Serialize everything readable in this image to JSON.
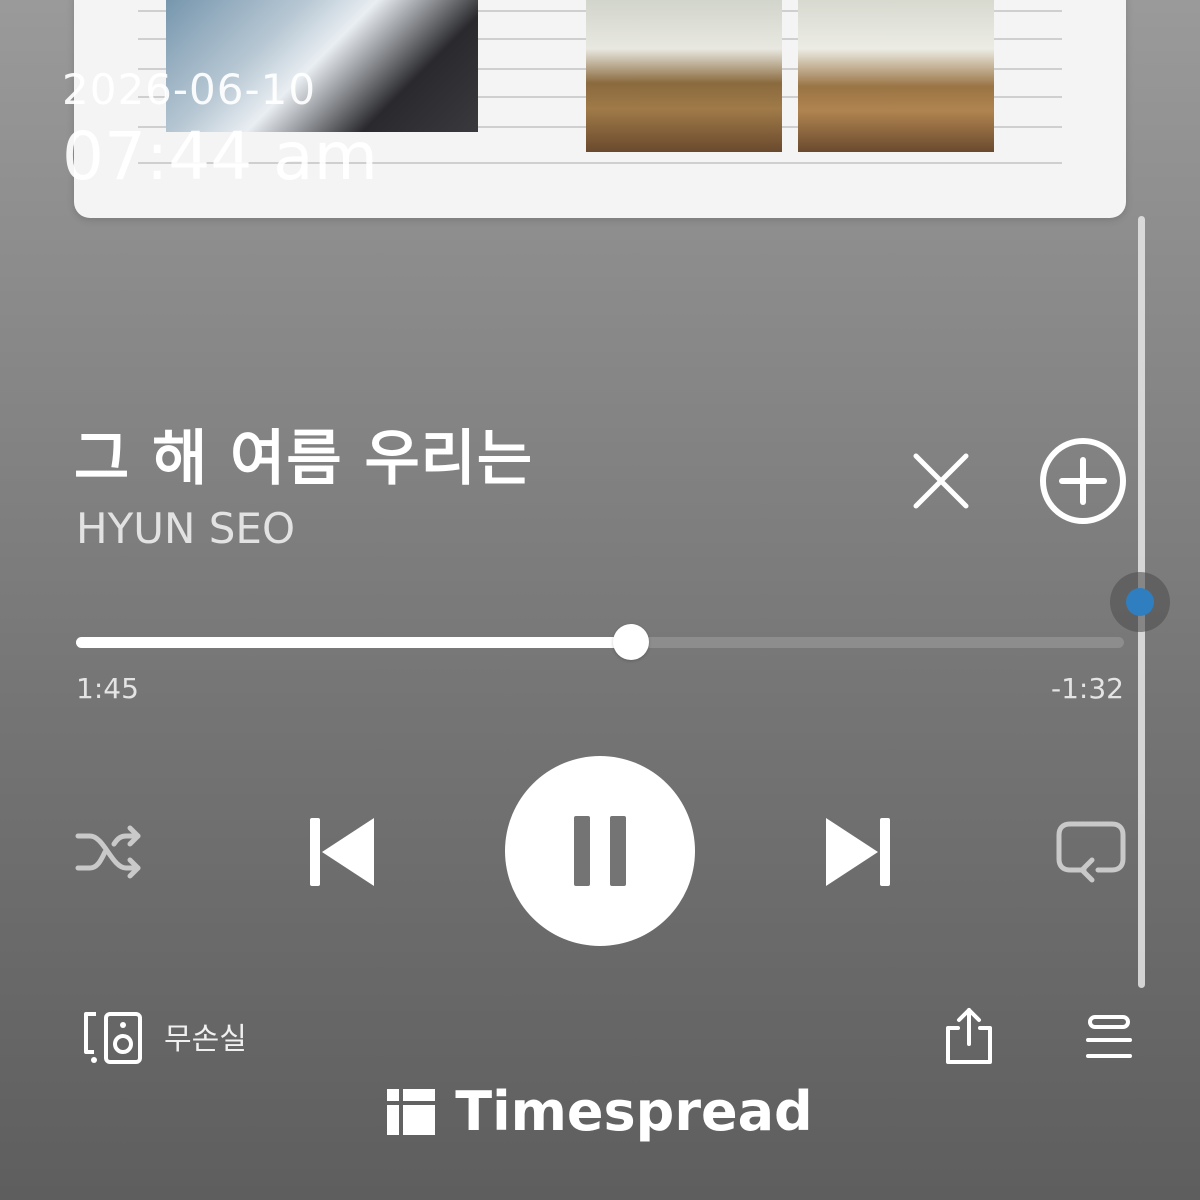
{
  "status": {
    "date": "2026-06-10",
    "time": "07:44 am"
  },
  "track": {
    "title": "그 해 여름 우리는",
    "artist": "HYUN SEO"
  },
  "playback": {
    "elapsed": "1:45",
    "remaining": "-1:32",
    "progress_fraction": 0.53,
    "state": "playing"
  },
  "output": {
    "label": "무손실"
  },
  "watermark": {
    "text": "Timespread"
  },
  "colors": {
    "accent": "#2f7fc0",
    "foreground": "#ffffff"
  },
  "icons": {
    "close": "close-icon",
    "add": "plus-circle-icon",
    "shuffle": "shuffle-icon",
    "previous": "skip-previous-icon",
    "pause": "pause-icon",
    "next": "skip-next-icon",
    "repeat": "repeat-icon",
    "device": "speaker-device-icon",
    "share": "share-icon",
    "queue": "queue-list-icon"
  }
}
